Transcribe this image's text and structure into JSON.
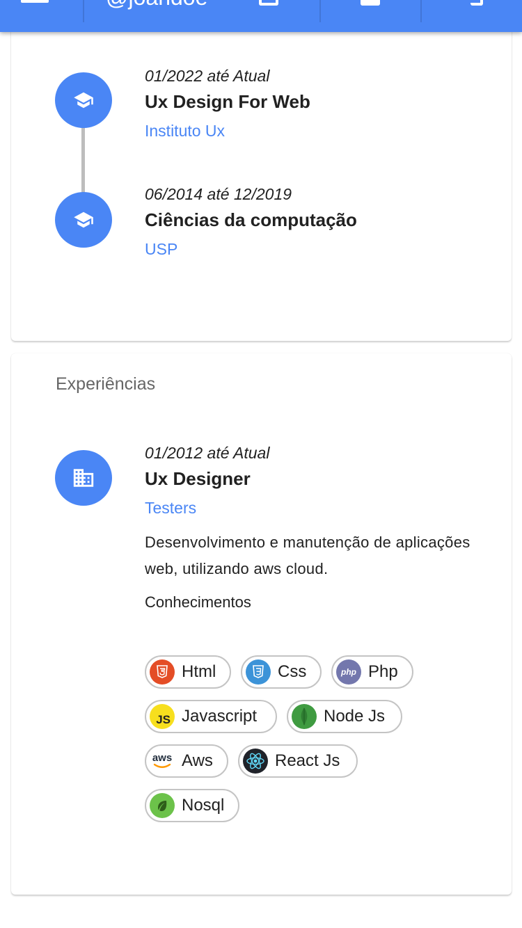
{
  "appbar": {
    "handle": "@joandoe",
    "icons": [
      "menu-icon",
      "copy-icon",
      "save-icon",
      "share-icon"
    ]
  },
  "education": {
    "items": [
      {
        "date": "01/2022 até Atual",
        "title": "Ux Design For Web",
        "org": "Instituto Ux",
        "icon": "graduation-cap-icon"
      },
      {
        "date": "06/2014 até 12/2019",
        "title": "Ciências da computação",
        "org": "USP",
        "icon": "graduation-cap-icon"
      }
    ]
  },
  "experience": {
    "section_title": "Experiências",
    "item": {
      "date": "01/2012 até Atual",
      "title": "Ux Designer",
      "org": "Testers",
      "description": "Desenvolvimento e manutenção de aplicações web, utilizando aws cloud.",
      "skills_label": "Conhecimentos",
      "icon": "building-icon"
    },
    "skills": [
      {
        "label": "Html",
        "icon": "html5-icon",
        "color": "#e44d26"
      },
      {
        "label": "Css",
        "icon": "css3-icon",
        "color": "#3c93d8"
      },
      {
        "label": "Php",
        "icon": "php-icon",
        "color": "#7377ad"
      },
      {
        "label": "Javascript",
        "icon": "javascript-icon",
        "color": "#f7df1e"
      },
      {
        "label": "Node Js",
        "icon": "mongodb-leaf-icon",
        "color": "#3f9b41"
      },
      {
        "label": "Aws",
        "icon": "aws-icon",
        "color": "#ff9900"
      },
      {
        "label": "React Js",
        "icon": "react-icon",
        "color": "#61dafb"
      },
      {
        "label": "Nosql",
        "icon": "leaf-icon",
        "color": "#6cc24a"
      }
    ]
  },
  "colors": {
    "primary": "#4a86f5",
    "divider": "#bdbdbd"
  }
}
